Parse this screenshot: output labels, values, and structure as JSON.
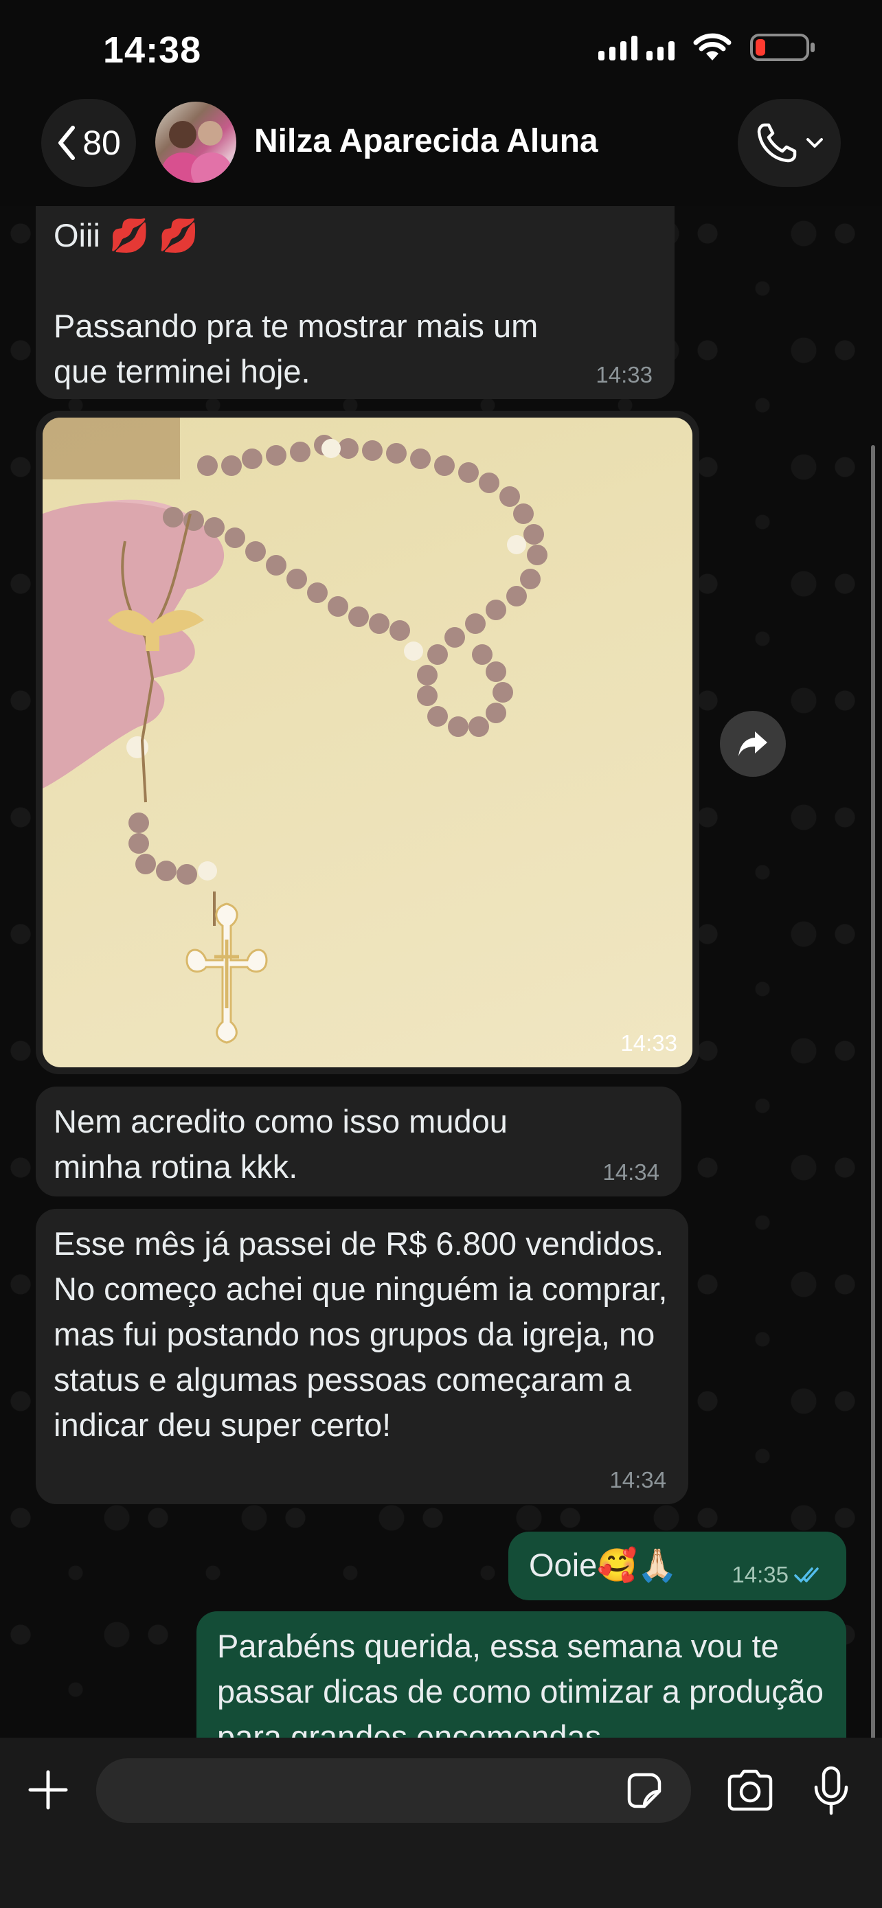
{
  "status_bar": {
    "time": "14:38"
  },
  "header": {
    "back_count": "80",
    "contact_name": "Nilza Aparecida Aluna"
  },
  "messages": [
    {
      "direction": "in",
      "text": "Oiii 💋 💋\n\nPassando pra te mostrar mais um que terminei hoje.",
      "time": "14:33"
    },
    {
      "direction": "in",
      "type": "image",
      "time": "14:33"
    },
    {
      "direction": "in",
      "text": "Nem acredito como isso mudou minha rotina kkk.",
      "time": "14:34"
    },
    {
      "direction": "in",
      "text": "Esse mês já passei de R$ 6.800 vendidos. No começo achei que ninguém ia comprar, mas fui postando nos grupos da igreja, no status e algumas pessoas começaram a indicar deu super certo!",
      "time": "14:34"
    },
    {
      "direction": "out",
      "text": "Ooie🥰🙏🏻",
      "time": "14:35",
      "status": "read"
    },
    {
      "direction": "out",
      "text": "Parabéns querida, essa semana vou te passar dicas de como otimizar a produção para grandes encomendas"
    }
  ],
  "colors": {
    "incoming_bubble": "#212121",
    "outgoing_bubble": "#144d37",
    "read_ticks": "#53bdeb",
    "battery_low": "#ff3b30"
  },
  "icons": [
    "chevron-left-icon",
    "phone-icon",
    "chevron-down-icon",
    "forward-icon",
    "plus-icon",
    "sticker-icon",
    "camera-icon",
    "microphone-icon",
    "double-check-icon"
  ]
}
